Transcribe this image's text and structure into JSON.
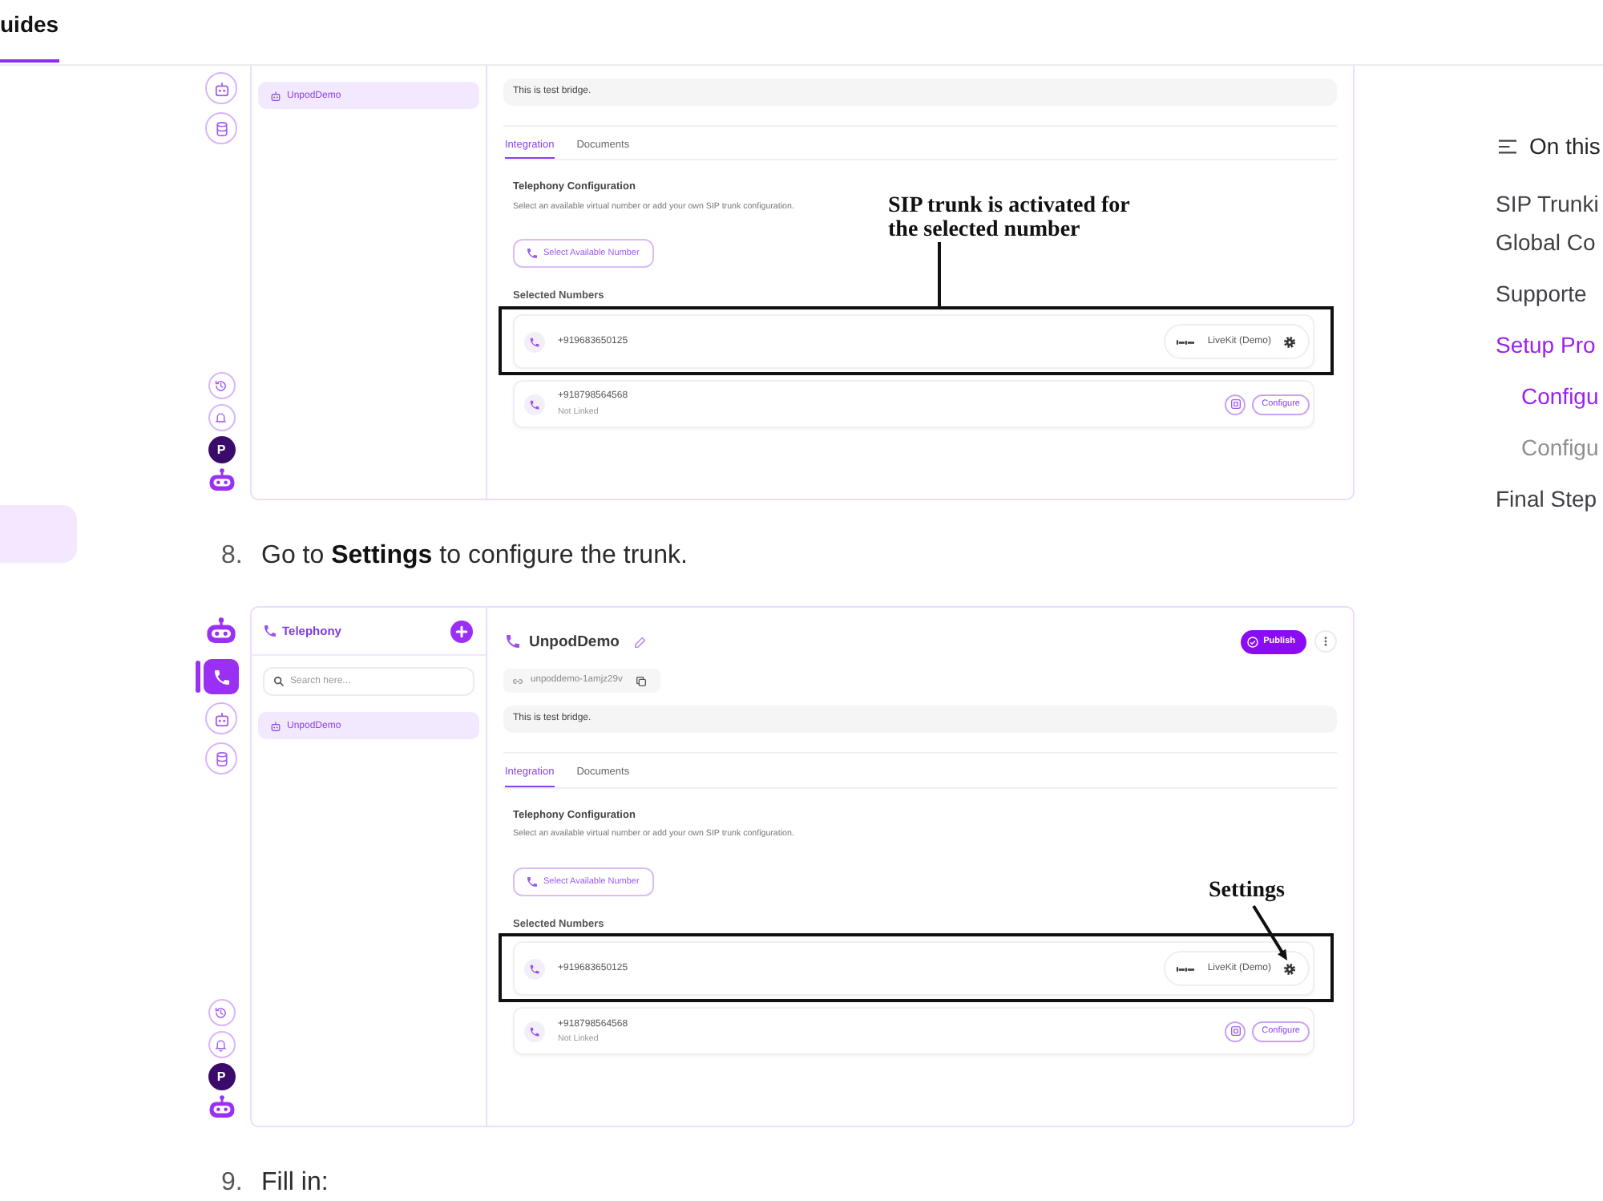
{
  "top_nav": {
    "tabs": [
      {
        "label": "uides",
        "selected": true
      }
    ]
  },
  "sidebar": {
    "items": [
      {
        "selected": true
      }
    ]
  },
  "content": {
    "blocks": [
      {
        "kind": "screenshot",
        "rail": {
          "top": [
            {
              "kind": "agents",
              "selected": false
            },
            {
              "kind": "data",
              "selected": false
            }
          ],
          "bottom": [
            {
              "kind": "history",
              "selected": false
            },
            {
              "kind": "notifications",
              "selected": false
            },
            {
              "kind": "avatar",
              "label": "P"
            },
            {
              "kind": "logo"
            }
          ]
        },
        "panel": {
          "items": [
            {
              "label": "UnpodDemo",
              "selected": true
            }
          ]
        },
        "detail": {
          "description": "This is test bridge.",
          "tabs": [
            {
              "label": "Integration",
              "selected": true
            },
            {
              "label": "Documents",
              "selected": false
            }
          ],
          "section_title": "Telephony Configuration",
          "section_subtitle": "Select an available virtual number or add your own SIP trunk configuration.",
          "select_button": "Select Available Number",
          "numbers_title": "Selected Numbers",
          "numbers": [
            {
              "kind": "linked",
              "number": "+919683650125",
              "provider": "LiveKit (Demo)",
              "highlighted": true
            },
            {
              "kind": "unlinked",
              "number": "+918798564568",
              "status": "Not Linked",
              "action": "Configure",
              "highlighted": false
            }
          ]
        },
        "annotation": {
          "kind": "callout",
          "text": "SIP trunk is activated for the selected number"
        }
      },
      {
        "kind": "step",
        "number": "8.",
        "text": "Go to **Settings** to configure the trunk."
      },
      {
        "kind": "screenshot",
        "rail": {
          "top": [
            {
              "kind": "logo"
            },
            {
              "kind": "telephony",
              "selected": true
            },
            {
              "kind": "agents",
              "selected": false
            },
            {
              "kind": "data",
              "selected": false
            }
          ],
          "bottom": [
            {
              "kind": "history",
              "selected": false
            },
            {
              "kind": "notifications",
              "selected": false
            },
            {
              "kind": "avatar",
              "label": "P"
            },
            {
              "kind": "logo"
            }
          ]
        },
        "panel": {
          "title": "Telephony",
          "search": {
            "placeholder": "Search here..."
          },
          "items": [
            {
              "label": "UnpodDemo",
              "selected": true
            }
          ]
        },
        "detail": {
          "title": "UnpodDemo",
          "publish_button": "Publish",
          "slug": "unpoddemo-1amjz29v",
          "description": "This is test bridge.",
          "tabs": [
            {
              "label": "Integration",
              "selected": true
            },
            {
              "label": "Documents",
              "selected": false
            }
          ],
          "section_title": "Telephony Configuration",
          "section_subtitle": "Select an available virtual number or add your own SIP trunk configuration.",
          "select_button": "Select Available Number",
          "numbers_title": "Selected Numbers",
          "numbers": [
            {
              "kind": "linked",
              "number": "+919683650125",
              "provider": "LiveKit (Demo)",
              "highlighted": true
            },
            {
              "kind": "unlinked",
              "number": "+918798564568",
              "status": "Not Linked",
              "action": "Configure",
              "highlighted": false
            }
          ]
        },
        "annotation": {
          "kind": "arrow",
          "text": "Settings"
        }
      },
      {
        "kind": "step",
        "number": "9.",
        "text": "Fill in:"
      }
    ]
  },
  "toc": {
    "title": "On this",
    "items": [
      {
        "label": "SIP Trunki\nGlobal Co",
        "selected": false
      },
      {
        "label": "Supporte",
        "selected": false
      },
      {
        "label": "Setup Pro",
        "selected": true,
        "children": [
          {
            "label": "Configu",
            "selected": true
          },
          {
            "label": "Configu",
            "selected": false
          }
        ]
      },
      {
        "label": "Final Step",
        "selected": false
      }
    ]
  }
}
